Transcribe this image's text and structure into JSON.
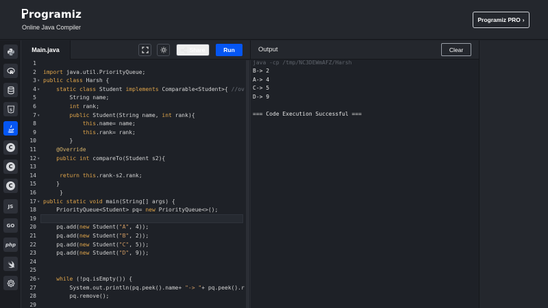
{
  "header": {
    "logo_text": "rogramiz",
    "subtitle": "Online Java Compiler",
    "pro_button": "Programiz PRO",
    "pro_chevron": "›"
  },
  "languages": [
    {
      "name": "python",
      "icon": "python-icon",
      "label": ""
    },
    {
      "name": "r",
      "icon": "r-icon",
      "label": "R"
    },
    {
      "name": "sql",
      "icon": "database-icon",
      "label": ""
    },
    {
      "name": "html",
      "icon": "html5-icon",
      "label": "5"
    },
    {
      "name": "java",
      "icon": "java-icon",
      "label": "",
      "active": true
    },
    {
      "name": "c",
      "icon": "c-icon",
      "label": "C"
    },
    {
      "name": "cpp",
      "icon": "cpp-icon",
      "label": "C"
    },
    {
      "name": "csharp",
      "icon": "csharp-icon",
      "label": "C"
    },
    {
      "name": "javascript",
      "icon": "js-icon",
      "label": "JS"
    },
    {
      "name": "go",
      "icon": "go-icon",
      "label": "GO"
    },
    {
      "name": "php",
      "icon": "php-icon",
      "label": "php"
    },
    {
      "name": "swift",
      "icon": "swift-icon",
      "label": ""
    },
    {
      "name": "rust",
      "icon": "rust-icon",
      "label": ""
    }
  ],
  "editor": {
    "file_name": "Main.java",
    "share_label": "Share",
    "run_label": "Run",
    "lines": [
      {
        "n": "1",
        "text": ""
      },
      {
        "n": "2",
        "text": "import java.util.PriorityQueue;",
        "fold": false
      },
      {
        "n": "3",
        "text": "public class Harsh {",
        "fold": true
      },
      {
        "n": "4",
        "text": "    static class Student implements Comparable<Student>{ //ov",
        "fold": true
      },
      {
        "n": "5",
        "text": "        String name;"
      },
      {
        "n": "6",
        "text": "        int rank;"
      },
      {
        "n": "7",
        "text": "        public Student(String name, int rank){",
        "fold": true
      },
      {
        "n": "8",
        "text": "            this.name= name;"
      },
      {
        "n": "9",
        "text": "            this.rank= rank;"
      },
      {
        "n": "10",
        "text": "        }"
      },
      {
        "n": "11",
        "text": "    @Override"
      },
      {
        "n": "12",
        "text": "    public int compareTo(Student s2){",
        "fold": true
      },
      {
        "n": "13",
        "text": ""
      },
      {
        "n": "14",
        "text": "     return this.rank-s2.rank;"
      },
      {
        "n": "15",
        "text": "    }"
      },
      {
        "n": "16",
        "text": "     }"
      },
      {
        "n": "17",
        "text": "public static void main(String[] args) {",
        "fold": true
      },
      {
        "n": "18",
        "text": "    PriorityQueue<Student> pq= new PriorityQueue<>();"
      },
      {
        "n": "19",
        "text": ""
      },
      {
        "n": "20",
        "text": "    pq.add(new Student(\"A\", 4));"
      },
      {
        "n": "21",
        "text": "    pq.add(new Student(\"B\", 2));"
      },
      {
        "n": "22",
        "text": "    pq.add(new Student(\"C\", 5));"
      },
      {
        "n": "23",
        "text": "    pq.add(new Student(\"D\", 9));"
      },
      {
        "n": "24",
        "text": ""
      },
      {
        "n": "25",
        "text": ""
      },
      {
        "n": "26",
        "text": "    while (!pq.isEmpty()) {",
        "fold": true
      },
      {
        "n": "27",
        "text": "        System.out.println(pq.peek().name+ \"-> \"+ pq.peek().r"
      },
      {
        "n": "28",
        "text": "        pq.remove();"
      },
      {
        "n": "29",
        "text": ""
      }
    ]
  },
  "output": {
    "title": "Output",
    "clear_label": "Clear",
    "command": "java -cp /tmp/NC3DEWmAFZ/Harsh",
    "lines": [
      "B-> 2",
      "A-> 4",
      "C-> 5",
      "D-> 9",
      "",
      "=== Code Execution Successful ==="
    ]
  },
  "colors": {
    "accent": "#0556f3",
    "background": "#1e2127",
    "header": "#24272d"
  }
}
